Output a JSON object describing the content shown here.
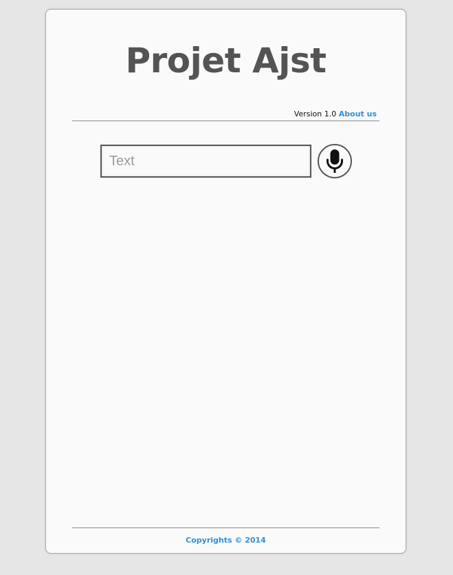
{
  "header": {
    "title": "Projet Ajst",
    "version": "Version 1.0",
    "about_link": "About us"
  },
  "search": {
    "placeholder": "Text",
    "value": "",
    "mic_icon": "microphone-icon"
  },
  "footer": {
    "copyright": "Copyrights © 2014"
  },
  "colors": {
    "background": "#e6e6e6",
    "card": "#fafafa",
    "title": "#545454",
    "link": "#2e8fdc"
  }
}
